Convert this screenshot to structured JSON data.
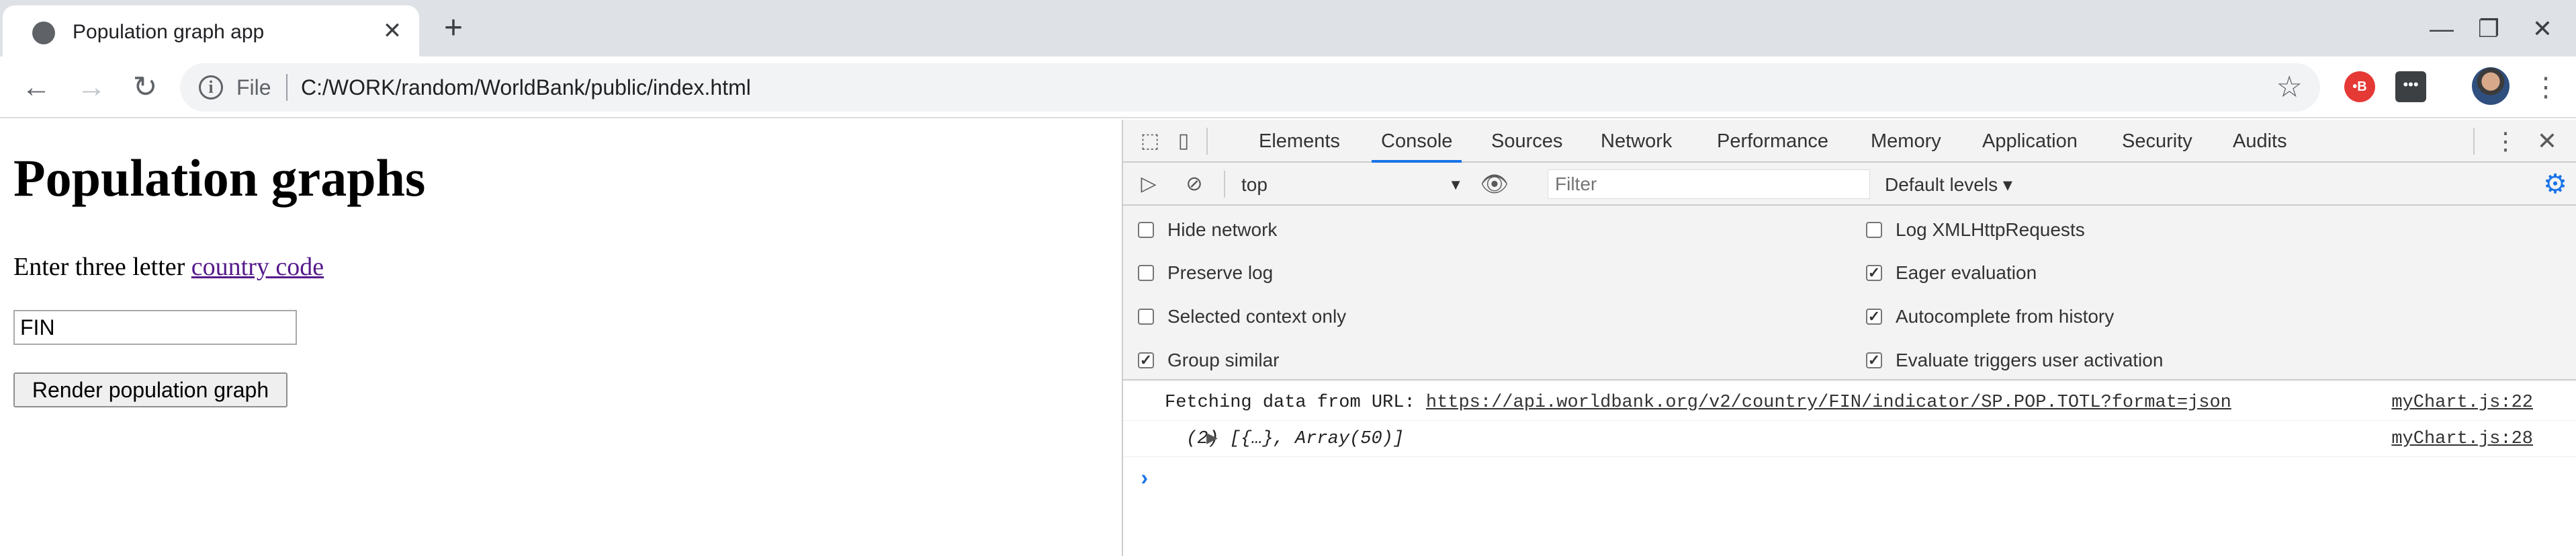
{
  "tab": {
    "title": "Population graph app",
    "close": "✕"
  },
  "window": {
    "new_tab": "+",
    "minimize": "—",
    "restore": "❐",
    "close": "✕"
  },
  "toolbar": {
    "back": "←",
    "forward": "→",
    "reload": "↻",
    "info": "i",
    "scheme_label": "File",
    "url": "C:/WORK/random/WorldBank/public/index.html",
    "star": "☆",
    "extension_red": "•B",
    "extension_dark": "•••",
    "menu": "⋮"
  },
  "page": {
    "title": "Population graphs",
    "prompt_prefix": "Enter three letter ",
    "prompt_link": "country code",
    "country_input_value": "FIN",
    "render_button": "Render population graph"
  },
  "devtools": {
    "tabs": [
      "Elements",
      "Console",
      "Sources",
      "Network",
      "Performance",
      "Memory",
      "Application",
      "Security",
      "Audits"
    ],
    "active_tab": "Console",
    "context": "top",
    "filter_placeholder": "Filter",
    "levels": "Default levels ▾",
    "settings": [
      {
        "label": "Hide network",
        "checked": false
      },
      {
        "label": "Log XMLHttpRequests",
        "checked": false
      },
      {
        "label": "Preserve log",
        "checked": false
      },
      {
        "label": "Eager evaluation",
        "checked": true
      },
      {
        "label": "Selected context only",
        "checked": false
      },
      {
        "label": "Autocomplete from history",
        "checked": true
      },
      {
        "label": "Group similar",
        "checked": true
      },
      {
        "label": "Evaluate triggers user activation",
        "checked": true
      }
    ],
    "logs": [
      {
        "prefix": "Fetching data from URL: ",
        "link": "https://api.worldbank.org/v2/country/FIN/indicator/SP.POP.TOTL?format=json",
        "source": "myChart.js:22"
      },
      {
        "text": "(2) [{…}, Array(50)]",
        "source": "myChart.js:28"
      }
    ],
    "prompt": "›"
  },
  "colors": {
    "accent": "#1a73e8",
    "link_visited": "#551a8b",
    "tabstrip": "#dee1e6"
  }
}
